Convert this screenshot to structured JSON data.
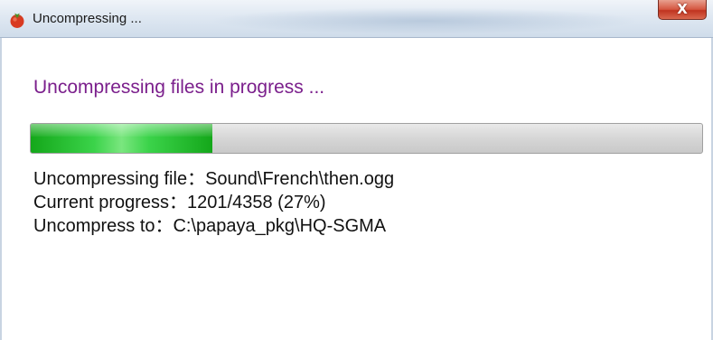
{
  "window": {
    "title": "Uncompressing ...",
    "close_label": "X",
    "app_icon": "tomato-icon"
  },
  "dialog": {
    "heading": "Uncompressing files in progress ...",
    "progress": {
      "current": 1201,
      "total": 4358,
      "fraction": 0.27
    },
    "lines": {
      "file": "Uncompressing file：Sound\\French\\then.ogg",
      "progress": "Current progress：1201/4358  (27%)",
      "destination": "Uncompress to：C:\\papaya_pkg\\HQ-SGMA"
    }
  },
  "colors": {
    "heading": "#7b1f8c",
    "progress_fill": "#2cc43a",
    "close_button": "#c8432e"
  }
}
